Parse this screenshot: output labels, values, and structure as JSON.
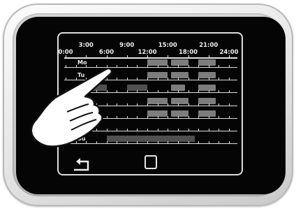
{
  "timeline": {
    "top_ticks": [
      "3:00",
      "9:00",
      "15:00",
      "21:00"
    ],
    "bottom_ticks": [
      "0:00",
      "6:00",
      "12:00",
      "18:00",
      "24:00"
    ]
  },
  "days": [
    {
      "label": "Mo",
      "segments": [
        [
          12,
          15,
          "l"
        ],
        [
          15.5,
          18,
          "l"
        ],
        [
          19.5,
          22,
          "l"
        ]
      ]
    },
    {
      "label": "Tu",
      "segments": [
        [
          12,
          15,
          "l"
        ],
        [
          15.5,
          18,
          "l"
        ],
        [
          19.5,
          22,
          "l"
        ]
      ]
    },
    {
      "label": "",
      "segments": [
        [
          3,
          6,
          "d"
        ],
        [
          9,
          12,
          "d"
        ],
        [
          15.5,
          17.5,
          "l"
        ],
        [
          19.5,
          22,
          "l"
        ]
      ]
    },
    {
      "label": "",
      "segments": [
        [
          12,
          15,
          "l"
        ],
        [
          15.5,
          18,
          "l"
        ],
        [
          19.5,
          22,
          "l"
        ]
      ]
    },
    {
      "label": "",
      "segments": [
        [
          12,
          15,
          "l"
        ],
        [
          15.5,
          18,
          "l"
        ],
        [
          19.5,
          22,
          "l"
        ]
      ]
    },
    {
      "label": "",
      "segments": []
    },
    {
      "label": "Su",
      "segments": [
        [
          6,
          19,
          "d"
        ]
      ]
    }
  ],
  "icons": {
    "back": "back-arrow-icon",
    "home": "home-square-icon",
    "hand": "pointing-hand-icon"
  }
}
